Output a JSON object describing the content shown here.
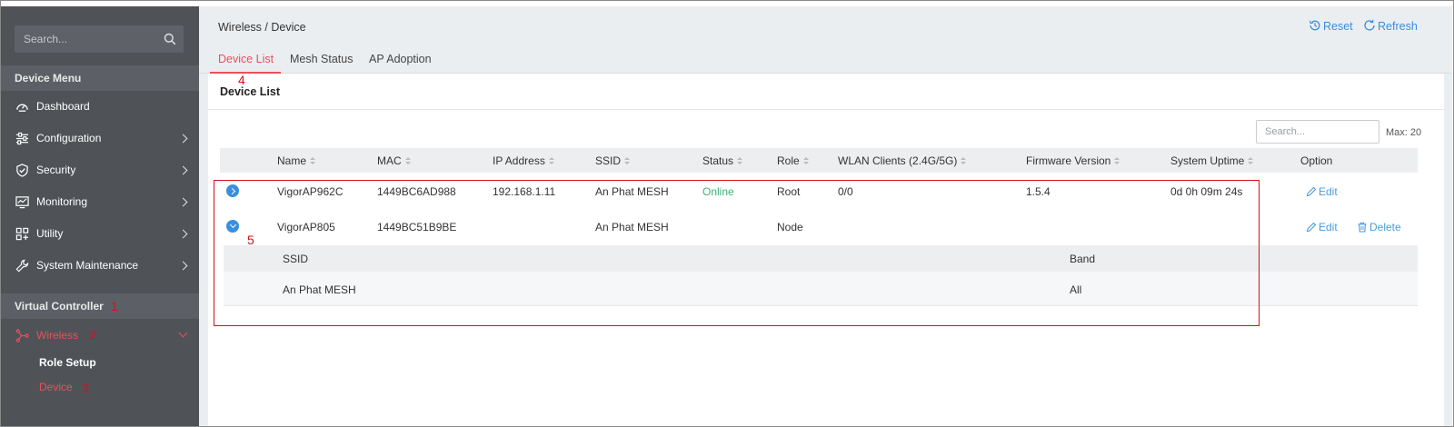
{
  "sidebar": {
    "search_placeholder": "Search...",
    "device_menu_header": "Device Menu",
    "items": [
      {
        "label": "Dashboard",
        "icon": "gauge-icon"
      },
      {
        "label": "Configuration",
        "icon": "sliders-icon"
      },
      {
        "label": "Security",
        "icon": "shield-check-icon"
      },
      {
        "label": "Monitoring",
        "icon": "monitor-chart-icon"
      },
      {
        "label": "Utility",
        "icon": "grid-plus-icon"
      },
      {
        "label": "System Maintenance",
        "icon": "wrench-icon"
      }
    ],
    "virtual_controller_header": "Virtual Controller",
    "wireless": {
      "label": "Wireless",
      "icon": "mesh-network-icon"
    },
    "subitems": [
      {
        "label": "Role Setup"
      },
      {
        "label": "Device"
      }
    ]
  },
  "annotations": [
    "1",
    "2",
    "3",
    "4",
    "5"
  ],
  "header": {
    "breadcrumb": "Wireless / Device",
    "reset_label": "Reset",
    "refresh_label": "Refresh"
  },
  "tabs": [
    {
      "label": "Device List",
      "active": true
    },
    {
      "label": "Mesh Status",
      "active": false
    },
    {
      "label": "AP Adoption",
      "active": false
    }
  ],
  "panel": {
    "title": "Device List",
    "search_placeholder": "Search...",
    "max_label": "Max: 20"
  },
  "table": {
    "columns": [
      "Name",
      "MAC",
      "IP Address",
      "SSID",
      "Status",
      "Role",
      "WLAN Clients (2.4G/5G)",
      "Firmware Version",
      "System Uptime",
      "Option"
    ],
    "rows": [
      {
        "name": "VigorAP962C",
        "mac": "1449BC6AD988",
        "ip": "192.168.1.11",
        "ssid": "An Phat MESH",
        "status": "Online",
        "role": "Root",
        "wlan_clients": "0/0",
        "firmware": "1.5.4",
        "uptime": "0d 0h 09m 24s",
        "edit": "Edit"
      },
      {
        "name": "VigorAP805",
        "mac": "1449BC51B9BE",
        "ip": "",
        "ssid": "An Phat MESH",
        "status": "",
        "role": "Node",
        "wlan_clients": "",
        "firmware": "",
        "uptime": "",
        "edit": "Edit",
        "delete": "Delete"
      }
    ],
    "subtable": {
      "columns": [
        "SSID",
        "Band"
      ],
      "rows": [
        {
          "ssid": "An Phat MESH",
          "band": "All"
        }
      ]
    }
  },
  "colors": {
    "sidebar_bg": "#4f5358",
    "accent_red": "#e8505b",
    "link_blue": "#3c8ddb",
    "online_green": "#3cb371",
    "annotation_red": "#d0141e"
  }
}
